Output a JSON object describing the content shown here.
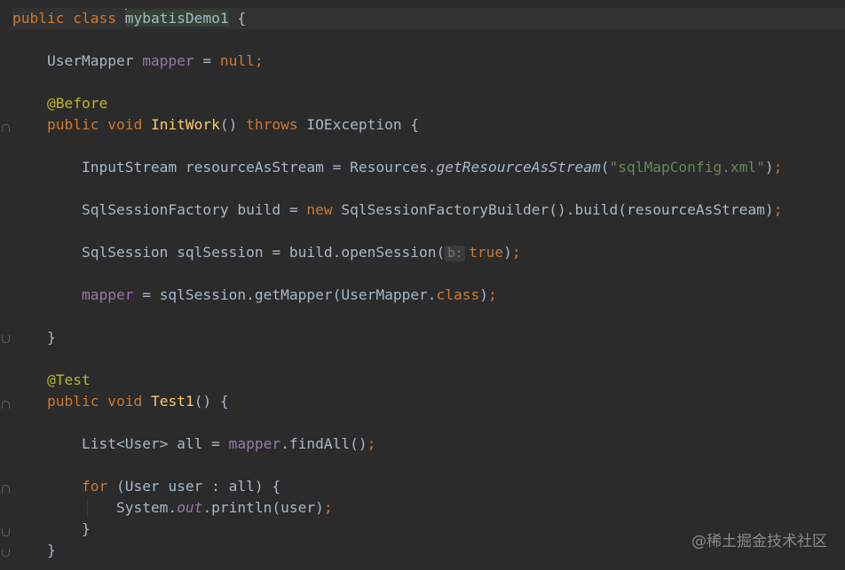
{
  "editor": {
    "class_decl": {
      "kw": "public class ",
      "name": "mybatisDemo1",
      "rest": " {"
    },
    "field_line": {
      "type": "UserMapper ",
      "name": "mapper",
      "eq": " = ",
      "val": "null",
      "semi": ";"
    },
    "before_ann": "@Before",
    "initwork_sig": {
      "kw1": "public ",
      "kw2": "void ",
      "name": "InitWork",
      "paren": "() ",
      "throws": "throws ",
      "ex": "IOException {"
    },
    "line_stream": {
      "a": "InputStream resourceAsStream = Resources.",
      "m": "getResourceAsStream",
      "p1": "(",
      "s": "\"sqlMapConfig.xml\"",
      "p2": ")",
      "semi": ";"
    },
    "line_factory": {
      "a": "SqlSessionFactory build = ",
      "kw": "new ",
      "b": "SqlSessionFactoryBuilder().build(resourceAsStream)",
      "semi": ";"
    },
    "line_session": {
      "a": "SqlSession sqlSession = build.openSession(",
      "hint": "b:",
      "val": "true",
      "p": ")",
      "semi": ";"
    },
    "line_mapper": {
      "f": "mapper",
      "a": " = sqlSession.getMapper(UserMapper.",
      "kw": "class",
      "p": ")",
      "semi": ";"
    },
    "close_brace": "}",
    "test_ann": "@Test",
    "test_sig": {
      "kw1": "public ",
      "kw2": "void ",
      "name": "Test1",
      "rest": "() {"
    },
    "line_list": {
      "a": "List<User> all = ",
      "f": "mapper",
      "b": ".findAll()",
      "semi": ";"
    },
    "line_for": {
      "kw": "for ",
      "a": "(User user : all) {"
    },
    "line_print": {
      "a": "System.",
      "f": "out",
      "b": ".println(user)",
      "semi": ";"
    },
    "inner_close": "}",
    "method_close": "}"
  },
  "watermark": "@稀土掘金技术社区",
  "colors": {
    "background": "#2b2b2b",
    "keyword": "#cc7832",
    "field": "#9876aa",
    "annotation": "#bbb529",
    "method": "#ffc66d",
    "string": "#6a8759",
    "default": "#a9b7c6"
  }
}
